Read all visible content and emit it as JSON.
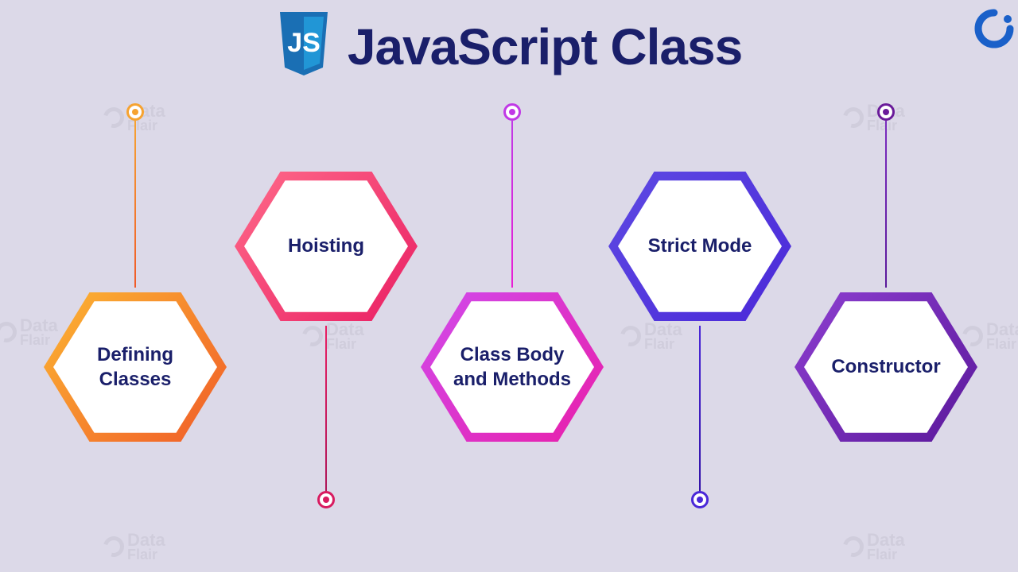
{
  "title": "JavaScript Class",
  "logo_text": "JS",
  "watermark": {
    "line1": "Data",
    "line2": "Flair"
  },
  "nodes": [
    {
      "label": "Defining Classes",
      "color_start": "#fcb733",
      "color_end": "#f05a28"
    },
    {
      "label": "Hoisting",
      "color_start": "#ff6b8a",
      "color_end": "#e91e63"
    },
    {
      "label": "Class Body and Methods",
      "color_start": "#d04bed",
      "color_end": "#e91ea8"
    },
    {
      "label": "Strict Mode",
      "color_start": "#5e4ae3",
      "color_end": "#4a28d8"
    },
    {
      "label": "Constructor",
      "color_start": "#8e3fd1",
      "color_end": "#5a189a"
    }
  ],
  "colors": {
    "background": "#dcd9e8",
    "title": "#1a1f6a",
    "label": "#1a1f6a"
  }
}
